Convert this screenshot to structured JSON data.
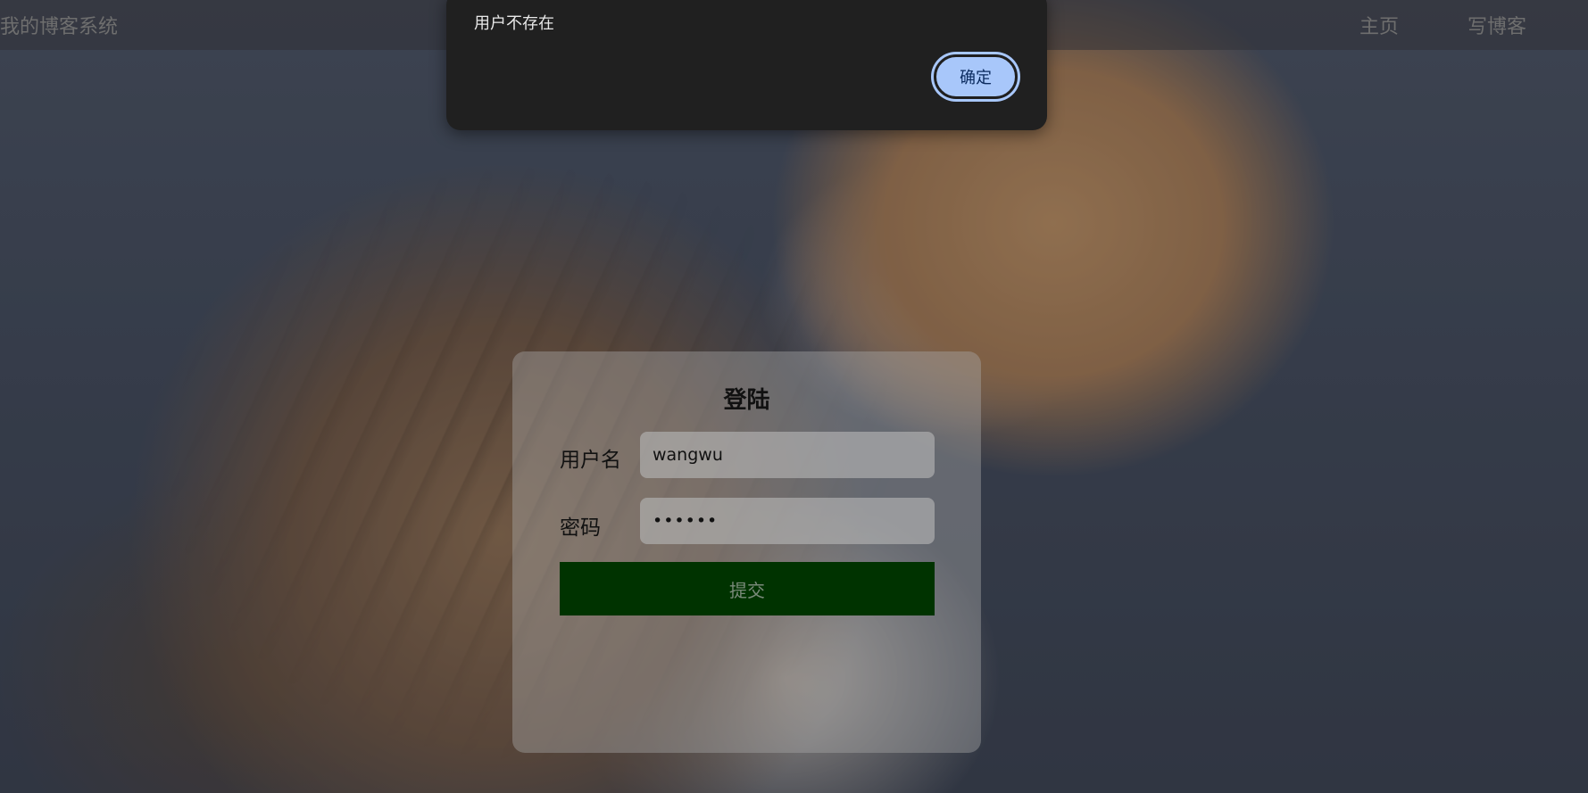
{
  "navbar": {
    "brand": "我的博客系统",
    "links": [
      {
        "label": "主页"
      },
      {
        "label": "写博客"
      }
    ]
  },
  "login": {
    "title": "登陆",
    "username_label": "用户名",
    "username_value": "wangwu",
    "password_label": "密码",
    "password_value": "••••••",
    "submit_label": "提交"
  },
  "dialog": {
    "message": "用户不存在",
    "ok_label": "确定"
  },
  "colors": {
    "submit_bg": "#003300",
    "dialog_bg": "#202020",
    "ok_button": "#a8c7fa"
  },
  "icons": {
    "background": "kitten-photo"
  }
}
